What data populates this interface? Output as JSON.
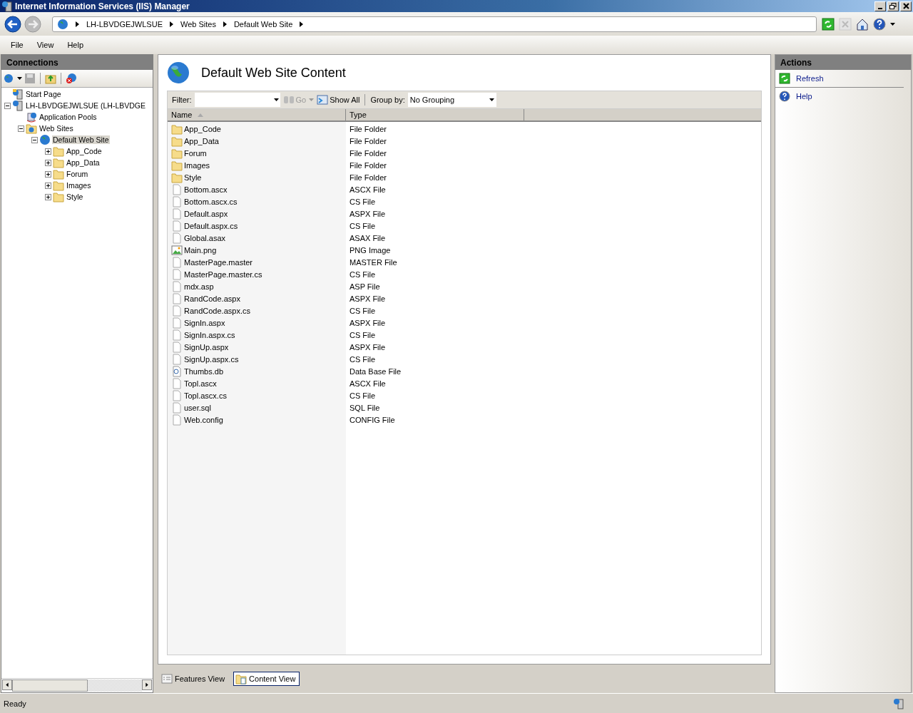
{
  "window": {
    "title": "Internet Information Services (IIS) Manager"
  },
  "address_bar": {
    "crumbs": [
      "LH-LBVDGEJWLSUE",
      "Web Sites",
      "Default Web Site"
    ]
  },
  "menu": [
    "File",
    "View",
    "Help"
  ],
  "connections": {
    "title": "Connections",
    "tree": [
      {
        "label": "Start Page",
        "kind": "page",
        "selected": false
      },
      {
        "label": "LH-LBVDGEJWLSUE (LH-LBVDGE",
        "kind": "server",
        "selected": false,
        "expanded": true,
        "children": [
          {
            "label": "Application Pools",
            "kind": "pools",
            "selected": false
          },
          {
            "label": "Web Sites",
            "kind": "sites",
            "selected": false,
            "expanded": true,
            "children": [
              {
                "label": "Default Web Site",
                "kind": "globe",
                "selected": true,
                "expanded": true,
                "children": [
                  {
                    "label": "App_Code",
                    "kind": "folder",
                    "selected": false,
                    "expanded": false
                  },
                  {
                    "label": "App_Data",
                    "kind": "folder",
                    "selected": false,
                    "expanded": false
                  },
                  {
                    "label": "Forum",
                    "kind": "folder",
                    "selected": false,
                    "expanded": false
                  },
                  {
                    "label": "Images",
                    "kind": "folder",
                    "selected": false,
                    "expanded": false
                  },
                  {
                    "label": "Style",
                    "kind": "folder",
                    "selected": false,
                    "expanded": false
                  }
                ]
              }
            ]
          }
        ]
      }
    ]
  },
  "content": {
    "title": "Default Web Site Content",
    "filter_label": "Filter:",
    "go": "Go",
    "show_all": "Show All",
    "group_by_label": "Group by:",
    "group_by": "No Grouping",
    "columns": [
      "Name",
      "Type"
    ],
    "rows": [
      {
        "name": "App_Code",
        "type": "File Folder",
        "kind": "folder"
      },
      {
        "name": "App_Data",
        "type": "File Folder",
        "kind": "folder"
      },
      {
        "name": "Forum",
        "type": "File Folder",
        "kind": "folder"
      },
      {
        "name": "Images",
        "type": "File Folder",
        "kind": "folder"
      },
      {
        "name": "Style",
        "type": "File Folder",
        "kind": "folder"
      },
      {
        "name": "Bottom.ascx",
        "type": "ASCX File",
        "kind": "file"
      },
      {
        "name": "Bottom.ascx.cs",
        "type": "CS File",
        "kind": "file"
      },
      {
        "name": "Default.aspx",
        "type": "ASPX File",
        "kind": "file"
      },
      {
        "name": "Default.aspx.cs",
        "type": "CS File",
        "kind": "file"
      },
      {
        "name": "Global.asax",
        "type": "ASAX File",
        "kind": "file"
      },
      {
        "name": "Main.png",
        "type": "PNG Image",
        "kind": "image"
      },
      {
        "name": "MasterPage.master",
        "type": "MASTER File",
        "kind": "file"
      },
      {
        "name": "MasterPage.master.cs",
        "type": "CS File",
        "kind": "file"
      },
      {
        "name": "mdx.asp",
        "type": "ASP File",
        "kind": "file"
      },
      {
        "name": "RandCode.aspx",
        "type": "ASPX File",
        "kind": "file"
      },
      {
        "name": "RandCode.aspx.cs",
        "type": "CS File",
        "kind": "file"
      },
      {
        "name": "SignIn.aspx",
        "type": "ASPX File",
        "kind": "file"
      },
      {
        "name": "SignIn.aspx.cs",
        "type": "CS File",
        "kind": "file"
      },
      {
        "name": "SignUp.aspx",
        "type": "ASPX File",
        "kind": "file"
      },
      {
        "name": "SignUp.aspx.cs",
        "type": "CS File",
        "kind": "file"
      },
      {
        "name": "Thumbs.db",
        "type": "Data Base File",
        "kind": "db"
      },
      {
        "name": "Topl.ascx",
        "type": "ASCX File",
        "kind": "file"
      },
      {
        "name": "Topl.ascx.cs",
        "type": "CS File",
        "kind": "file"
      },
      {
        "name": "user.sql",
        "type": "SQL File",
        "kind": "file"
      },
      {
        "name": "Web.config",
        "type": "CONFIG File",
        "kind": "file"
      }
    ],
    "view_tabs": [
      {
        "label": "Features View",
        "selected": false
      },
      {
        "label": "Content View",
        "selected": true
      }
    ]
  },
  "actions": {
    "title": "Actions",
    "items": [
      {
        "label": "Refresh",
        "kind": "refresh"
      },
      {
        "label": "Help",
        "kind": "help"
      }
    ]
  },
  "status_bar": "Ready"
}
